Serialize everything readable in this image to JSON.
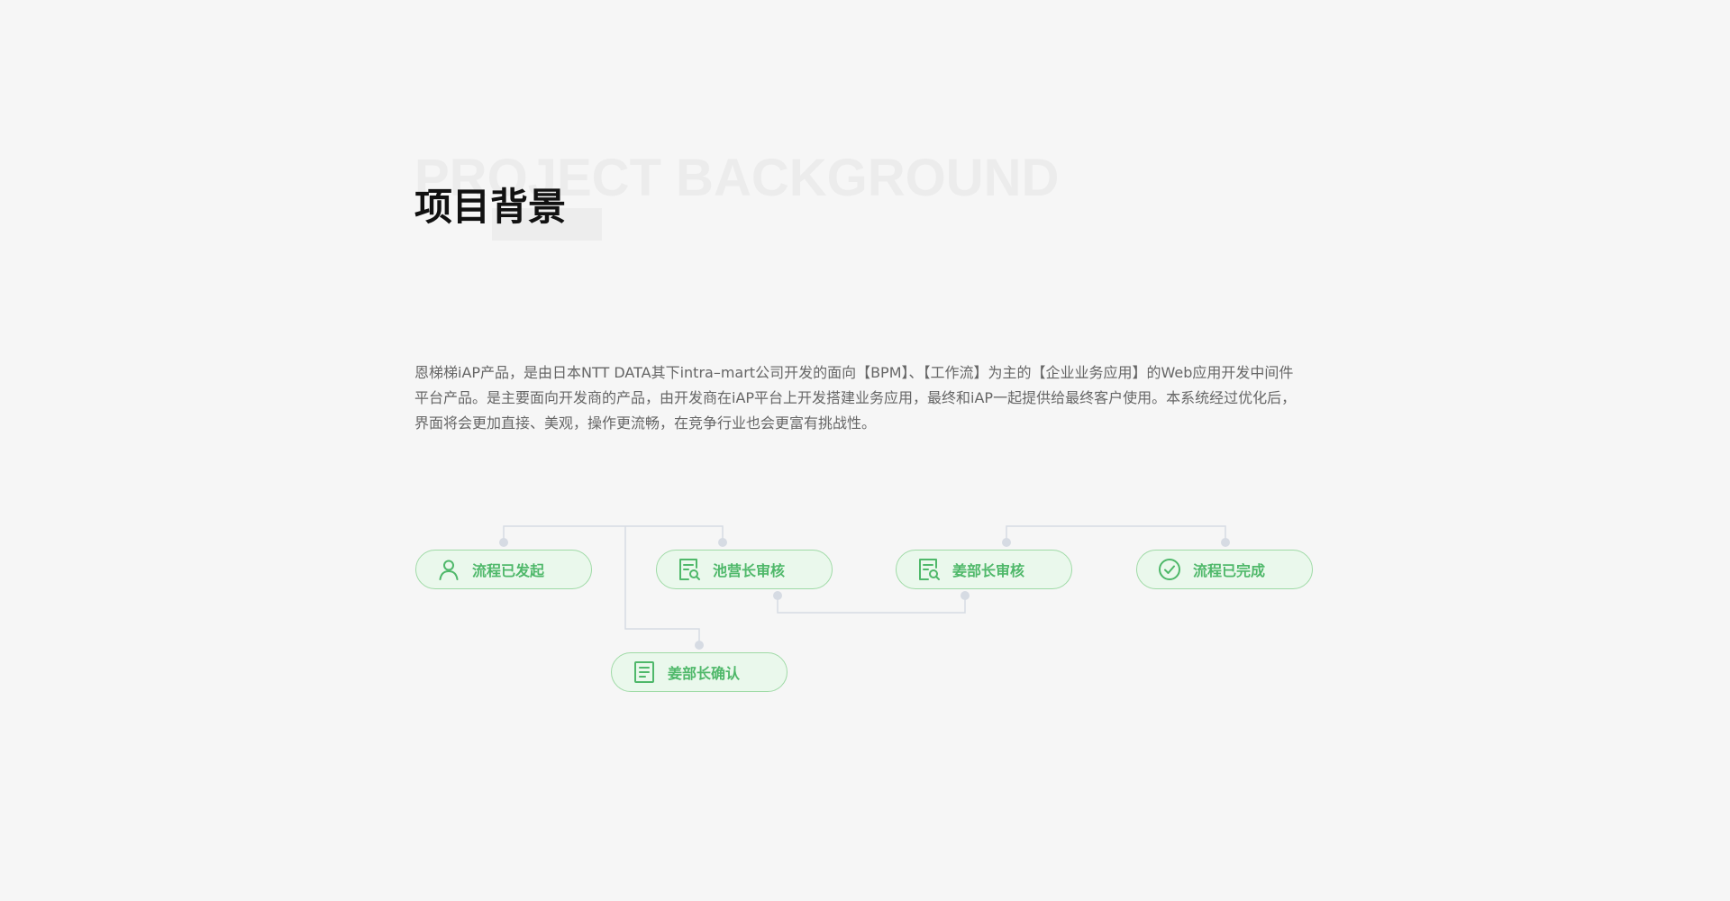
{
  "header": {
    "bg_text": "PROJECT BACKGROUND",
    "title": "项目背景"
  },
  "description": "恩梯梯iAP产品，是由日本NTT  DATA其下intra–mart公司开发的面向【BPM】、【工作流】为主的【企业业务应用】的Web应用开发中间件平台产品。是主要面向开发商的产品，由开发商在iAP平台上开发搭建业务应用，最终和iAP一起提供给最终客户使用。本系统经过优化后，界面将会更加直接、美观，操作更流畅，在竞争行业也会更富有挑战性。",
  "flow": {
    "colors": {
      "node_border": "#9fdaa6",
      "node_fill": "#eaf8ec",
      "node_text": "#4fb86a",
      "connector": "#d6dbe3"
    },
    "nodes": [
      {
        "id": "start",
        "label": "流程已发起",
        "icon": "user-icon"
      },
      {
        "id": "chi",
        "label": "池营长审核",
        "icon": "review-document-icon"
      },
      {
        "id": "jiang",
        "label": "姜部长审核",
        "icon": "review-document-icon"
      },
      {
        "id": "done",
        "label": "流程已完成",
        "icon": "check-circle-icon"
      },
      {
        "id": "confirm",
        "label": "姜部长确认",
        "icon": "document-icon"
      }
    ]
  }
}
